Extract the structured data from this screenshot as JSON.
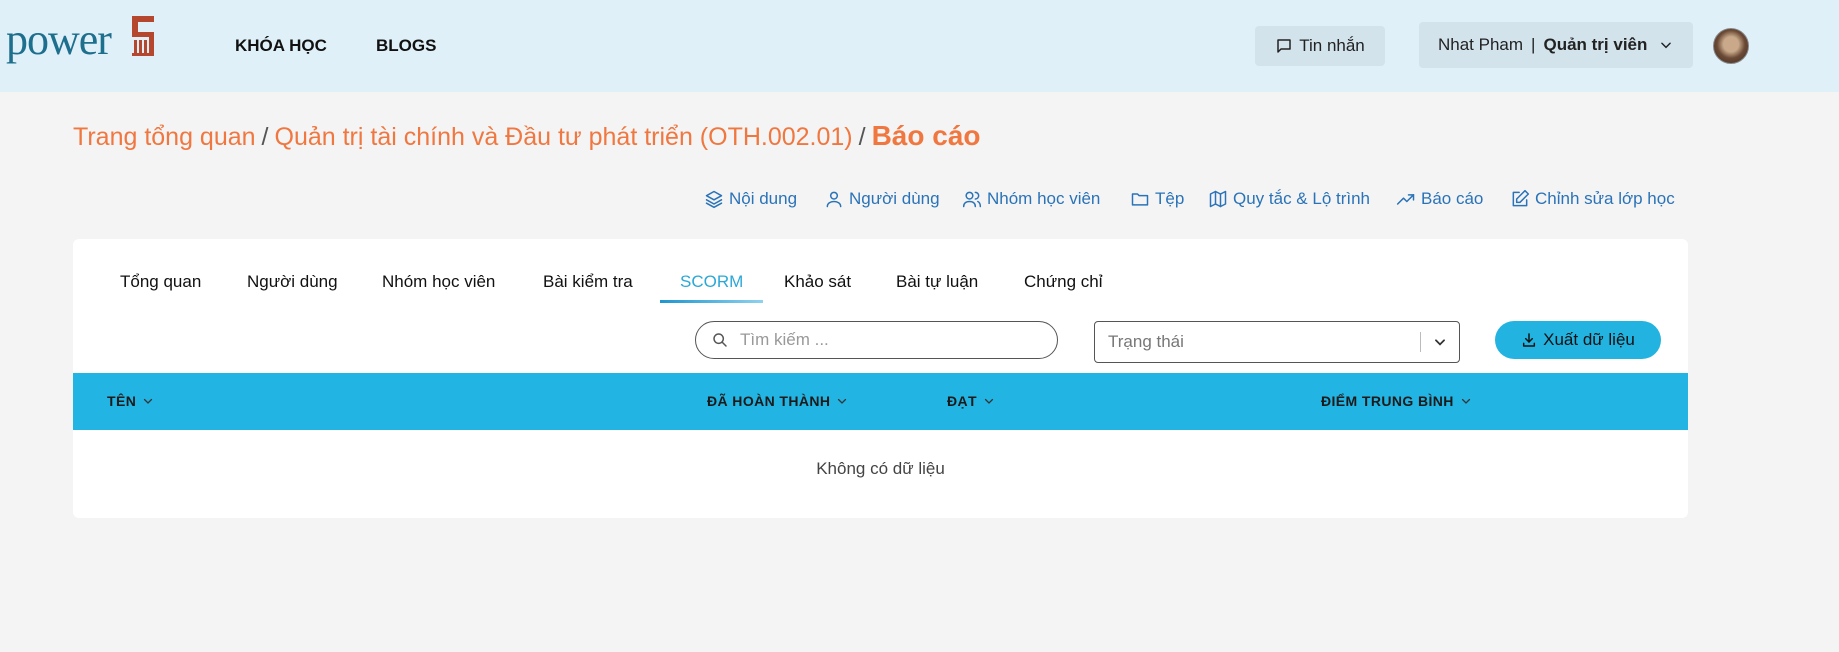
{
  "header": {
    "logo_text": "power",
    "logo_mark": "5",
    "nav": [
      "KHÓA HỌC",
      "BLOGS"
    ],
    "messages_label": "Tin nhắn",
    "user_name": "Nhat Pham",
    "user_separator": "|",
    "user_role": "Quản trị viên"
  },
  "breadcrumb": {
    "items": [
      "Trang tổng quan",
      "Quản trị tài chính và Đầu tư phát triển (OTH.002.01)"
    ],
    "separator": "/",
    "current": "Báo cáo"
  },
  "actions": [
    {
      "label": "Nội dung",
      "icon": "layers-icon"
    },
    {
      "label": "Người dùng",
      "icon": "user-icon"
    },
    {
      "label": "Nhóm học viên",
      "icon": "users-icon"
    },
    {
      "label": "Tệp",
      "icon": "folder-icon"
    },
    {
      "label": "Quy tắc & Lộ trình",
      "icon": "map-icon"
    },
    {
      "label": "Báo cáo",
      "icon": "trending-up-icon"
    },
    {
      "label": "Chỉnh sửa lớp học",
      "icon": "edit-icon"
    }
  ],
  "tabs": [
    "Tổng quan",
    "Người dùng",
    "Nhóm học viên",
    "Bài kiểm tra",
    "SCORM",
    "Khảo sát",
    "Bài tự luận",
    "Chứng chỉ"
  ],
  "active_tab": "SCORM",
  "filters": {
    "search_placeholder": "Tìm kiếm ...",
    "status_placeholder": "Trạng thái",
    "export_label": "Xuất dữ liệu"
  },
  "table": {
    "columns": [
      "TÊN",
      "ĐÃ HOÀN THÀNH",
      "ĐẠT",
      "ĐIỂM TRUNG BÌNH"
    ],
    "empty_text": "Không có dữ liệu"
  },
  "colors": {
    "header_bg": "#dff0f8",
    "accent_orange": "#f0773f",
    "link_blue": "#2a73b8",
    "table_header": "#22b4e2",
    "active_tab": "#2aa8d8"
  }
}
